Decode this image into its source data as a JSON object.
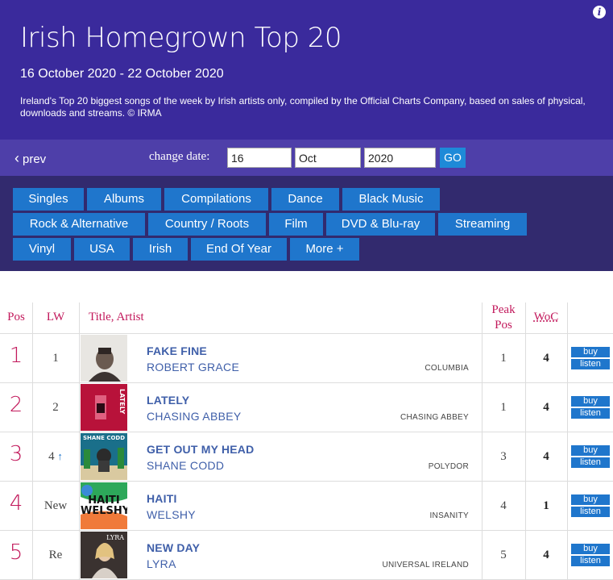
{
  "header": {
    "title": "Irish Homegrown Top 20",
    "dates": "16 October 2020 - 22 October 2020",
    "description": "Ireland's Top 20 biggest songs of the week by Irish artists only, compiled by the Official Charts Company, based on sales of physical, downloads and streams. © IRMA",
    "info_icon": "info-icon",
    "info_glyph": "i"
  },
  "datebar": {
    "prev_label": "prev",
    "prev_icon": "chevron-left-icon",
    "prev_glyph": "‹",
    "change_label": "change date:",
    "day": "16",
    "month": "Oct",
    "year": "2020",
    "go_label": "GO"
  },
  "nav": {
    "items": [
      "Singles",
      "Albums",
      "Compilations",
      "Dance",
      "Black Music",
      "Rock & Alternative",
      "Country / Roots",
      "Film",
      "DVD & Blu-ray",
      "Streaming",
      "Vinyl",
      "USA",
      "Irish",
      "End Of Year",
      "More +"
    ]
  },
  "table": {
    "headers": {
      "pos": "Pos",
      "lw": "LW",
      "title_artist": "Title, Artist",
      "peak_line1": "Peak",
      "peak_line2": "Pos",
      "woc": "WoC"
    },
    "buy_label": "buy",
    "listen_label": "listen",
    "up_arrow_glyph": "↑",
    "rows": [
      {
        "pos": "1",
        "lw": "1",
        "up": false,
        "title": "FAKE FINE",
        "artist": "ROBERT GRACE",
        "label": "COLUMBIA",
        "peak": "1",
        "woc": "4"
      },
      {
        "pos": "2",
        "lw": "2",
        "up": false,
        "title": "LATELY",
        "artist": "CHASING ABBEY",
        "label": "CHASING ABBEY",
        "peak": "1",
        "woc": "4",
        "cover_text": "LATELY"
      },
      {
        "pos": "3",
        "lw": "4",
        "up": true,
        "title": "GET OUT MY HEAD",
        "artist": "SHANE CODD",
        "label": "POLYDOR",
        "peak": "3",
        "woc": "4",
        "cover_text": "SHANE CODD"
      },
      {
        "pos": "4",
        "lw": "New",
        "up": false,
        "title": "HAITI",
        "artist": "WELSHY",
        "label": "INSANITY",
        "peak": "4",
        "woc": "1",
        "cover_text": "HAITI WELSHY"
      },
      {
        "pos": "5",
        "lw": "Re",
        "up": false,
        "title": "NEW DAY",
        "artist": "LYRA",
        "label": "UNIVERSAL IRELAND",
        "peak": "5",
        "woc": "4",
        "cover_text": "LYRA"
      }
    ]
  },
  "colors": {
    "header_bg": "#3a2a9c",
    "datebar_bg": "#4e3fa9",
    "nav_bg": "#322a6e",
    "nav_button": "#1f76cc",
    "go_button": "#1e8ad8",
    "accent_pink": "#c2185b",
    "link_blue": "#3f5fa9"
  }
}
